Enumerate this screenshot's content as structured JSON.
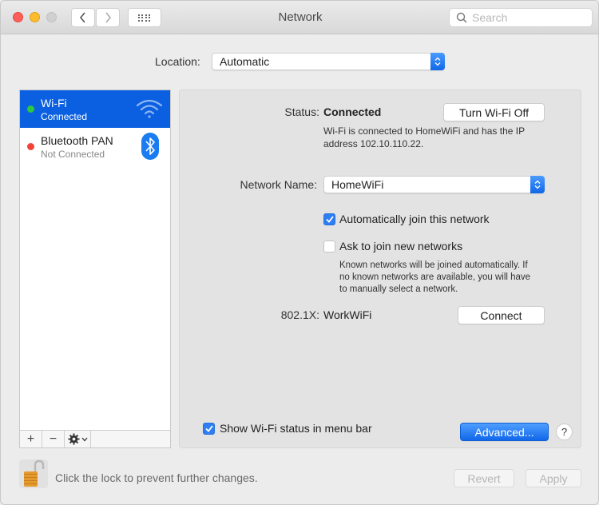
{
  "window": {
    "title": "Network",
    "traffic_lights": {
      "close": "#fc5f57",
      "minimize": "#fdbc2e",
      "zoom": "#d0d0d0"
    },
    "nav": {
      "back_icon": "chevron-left",
      "forward_icon": "chevron-right",
      "show_all_icon": "grid"
    },
    "search": {
      "placeholder": "Search",
      "value": ""
    }
  },
  "location": {
    "label": "Location:",
    "value": "Automatic"
  },
  "services": [
    {
      "name": "Wi-Fi",
      "status": "Connected",
      "status_color": "#2bc840",
      "icon": "wifi-icon",
      "selected": true
    },
    {
      "name": "Bluetooth PAN",
      "status": "Not Connected",
      "status_color": "#f0443a",
      "icon": "bluetooth-icon",
      "selected": false
    }
  ],
  "sidebar_footer": {
    "add": "+",
    "remove": "−",
    "action": "gear"
  },
  "detail": {
    "status_label": "Status:",
    "status_value": "Connected",
    "turn_off_button": "Turn Wi-Fi Off",
    "status_description_line1": "Wi-Fi is connected to HomeWiFi and has the IP",
    "status_description_line2": "address 102.10.110.22.",
    "network_name_label": "Network Name:",
    "network_name_value": "HomeWiFi",
    "auto_join": {
      "label": "Automatically join this network",
      "checked": true
    },
    "ask_join": {
      "label": "Ask to join new networks",
      "checked": false
    },
    "ask_join_help_line1": "Known networks will be joined automatically. If",
    "ask_join_help_line2": "no known networks are available, you will have",
    "ask_join_help_line3": "to manually select a network.",
    "dot1x_label": "802.1X:",
    "dot1x_value": "WorkWiFi",
    "connect_button": "Connect",
    "show_status": {
      "label": "Show Wi-Fi status in menu bar",
      "checked": true
    },
    "advanced_button": "Advanced...",
    "help_button": "?"
  },
  "footer": {
    "lock_message": "Click the lock to prevent further changes.",
    "revert_button": "Revert",
    "apply_button": "Apply"
  },
  "colors": {
    "accent": "#0a60e0",
    "button_blue": "#1168ea"
  }
}
